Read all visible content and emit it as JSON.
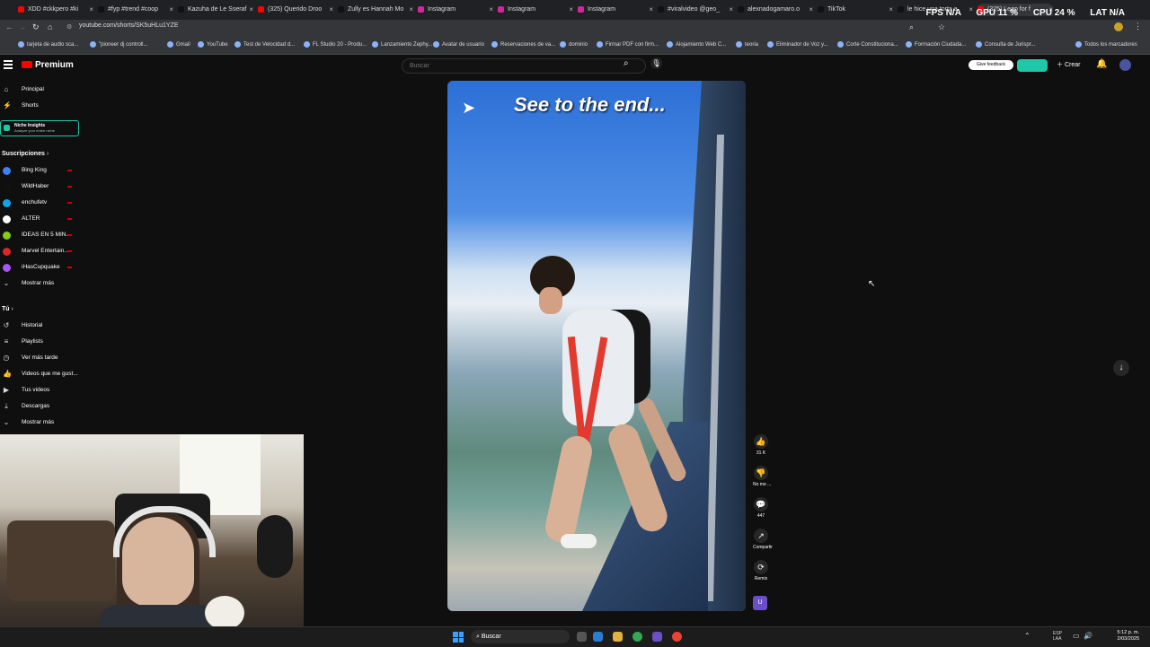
{
  "browser": {
    "tabs": [
      {
        "title": "XDD #ckkpero #ki",
        "color": "#ff0000"
      },
      {
        "title": "#fyp #trend #coop",
        "color": "#111"
      },
      {
        "title": "Kazuha de Le Sseraf",
        "color": "#111"
      },
      {
        "title": "(325) Querido Droo",
        "color": "#ff0000"
      },
      {
        "title": "Zully es Hannah Mo",
        "color": "#111"
      },
      {
        "title": "Instagram",
        "color": "#d6249f"
      },
      {
        "title": "Instagram",
        "color": "#d6249f"
      },
      {
        "title": "Instagram",
        "color": "#d6249f"
      },
      {
        "title": "#viralvideo @geo_",
        "color": "#111"
      },
      {
        "title": "alexnadogamaro.o",
        "color": "#111"
      },
      {
        "title": "TikTok",
        "color": "#111"
      },
      {
        "title": "le hice una torta a",
        "color": "#111"
      },
      {
        "title": "(325) Leap for f",
        "color": "#ff0000"
      }
    ],
    "perf": {
      "fps": "FPS N/A",
      "gpu": "GPU 11 %",
      "cpu": "CPU 24 %",
      "lat": "LAT N/A"
    },
    "url": "youtube.com/shorts/SK5uHLu1YZE",
    "bookmarks": [
      "tarjeta de audio sca...",
      "\"pioneer dj controll...",
      "Gmail",
      "YouTube",
      "Test de Velocidad d...",
      "FL Studio 20 - Produ...",
      "Lanzamiento Zephy...",
      "Avatar de usuario",
      "Reservaciones de va...",
      "dominio",
      "Firmar PDF con firm...",
      "Alojamiento Web C...",
      "teoria",
      "Eliminador de Voz y...",
      "Corte Constituciona...",
      "Formación Ciudada...",
      "Consulta de Jurispr...",
      "Todos los marcadores"
    ]
  },
  "header": {
    "logo_text": "Premium",
    "search_placeholder": "Buscar",
    "feedback_label": "Give feedback",
    "create_label": "Crear"
  },
  "sidebar": {
    "main": [
      "Principal",
      "Shorts"
    ],
    "niche": {
      "title": "Niche Insights",
      "subtitle": "Analyze your entire niche"
    },
    "subs_title": "Suscripciones",
    "subs": [
      {
        "name": "Bing King",
        "color": "#3b82f6"
      },
      {
        "name": "WildHaber",
        "color": "#111"
      },
      {
        "name": "enchufetv",
        "color": "#0ea5e9"
      },
      {
        "name": "ALTER",
        "color": "#fff"
      },
      {
        "name": "IDEAS EN 5 MIN...",
        "color": "#84cc16"
      },
      {
        "name": "Marvel Entertain...",
        "color": "#dc2626"
      },
      {
        "name": "iHasCupquake",
        "color": "#a855f7"
      }
    ],
    "show_more": "Mostrar más",
    "you_title": "Tú",
    "you_items": [
      "Historial",
      "Playlists",
      "Ver más tarde",
      "Videos que me gust...",
      "Tus videos",
      "Descargas",
      "Mostrar más"
    ]
  },
  "video": {
    "overlay_text": "See to the end..."
  },
  "actions": {
    "like_count": "31 K",
    "dislike_label": "No me ...",
    "comments_count": "447",
    "share_label": "Compartir",
    "remix_label": "Remix",
    "sound_avatar": "U"
  },
  "taskbar": {
    "search_label": "Buscar",
    "lang": "ESP\nLAA",
    "time": "5:12 p. m.",
    "date": "2/03/2025"
  }
}
